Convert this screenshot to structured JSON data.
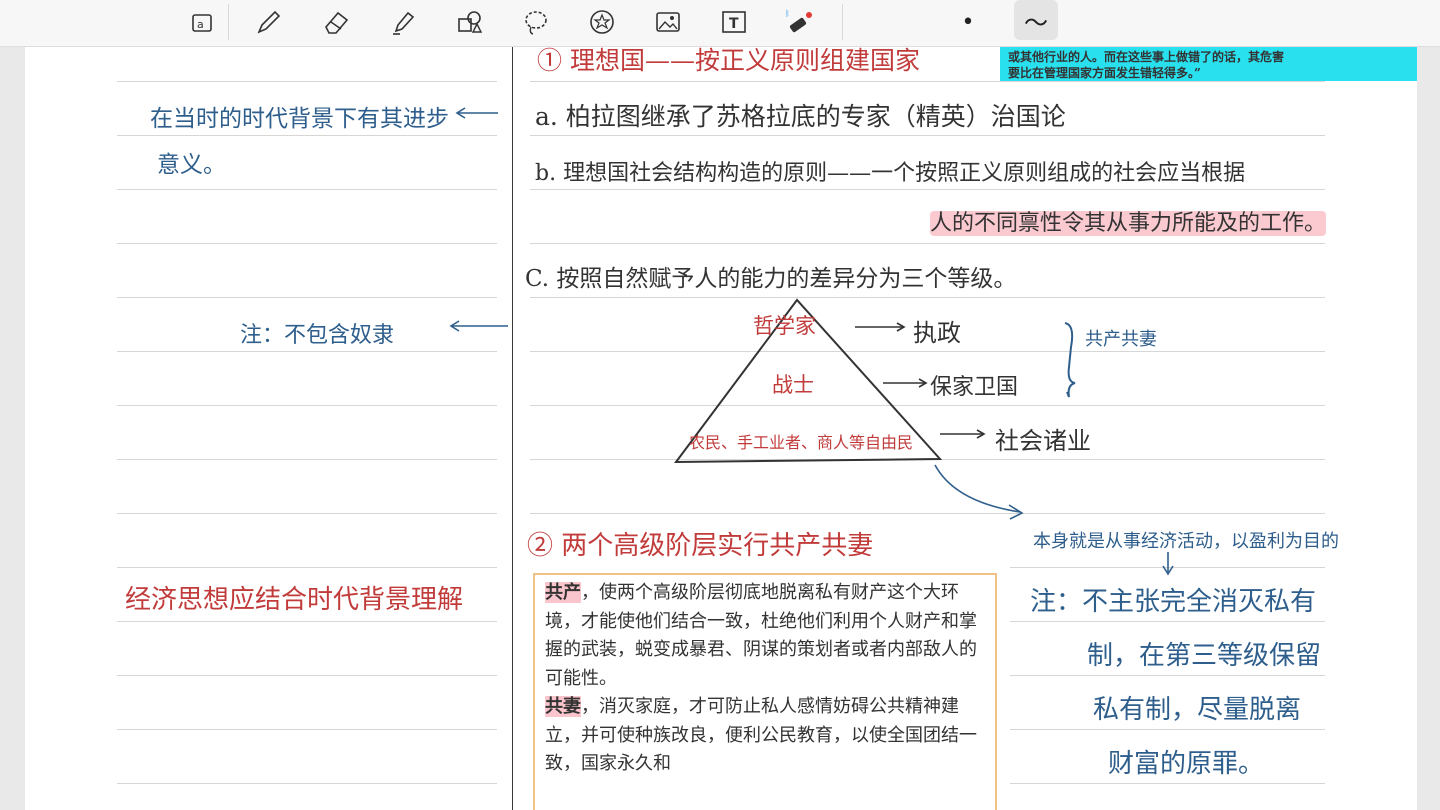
{
  "toolbar": {
    "tools": [
      "lasso-select-icon",
      "pen-icon",
      "eraser-icon",
      "highlighter-icon",
      "shapes-icon",
      "lasso-icon",
      "sticker-icon",
      "image-icon",
      "text-icon",
      "laser-pointer-icon"
    ],
    "pen_size": "•",
    "stroke_style": "～"
  },
  "left_notes": {
    "note1_line1": "在当时的时代背景下有其进步",
    "note1_line2": "意义。",
    "note2": "注：不包含奴隶",
    "note3": "经济思想应结合时代背景理解"
  },
  "main": {
    "heading1": "① 理想国——按正义原则组建国家",
    "item_a": "a. 柏拉图继承了苏格拉底的专家（精英）治国论",
    "item_b_line1": "b. 理想国社会结构构造的原则——一个按照正义原则组成的社会应当根据",
    "item_b_line2": "人的不同禀性令其从事力所能及的工作。",
    "item_c": "C. 按照自然赋予人的能力的差异分为三个等级。",
    "tier_top": "哲学家",
    "tier_mid": "战士",
    "tier_bottom": "农民、手工业者、商人等自由民",
    "role_top": "执政",
    "role_mid": "保家卫国",
    "role_bottom": "社会诸业",
    "brace_note": "共产共妻",
    "heading2": "② 两个高级阶层实行共产共妻"
  },
  "right_notes": {
    "note_a": "本身就是从事经济活动，以盈利为目的",
    "note_b_line1": "注：不主张完全消灭私有",
    "note_b_line2": "制，在第三等级保留",
    "note_b_line3": "私有制，尽量脱离",
    "note_b_line4": "财富的原罪。"
  },
  "cyan_box": {
    "line1": "或其他行业的人。而在这些事上做错了的话，其危害",
    "line2": "要比在管理国家方面发生错轻得多。”"
  },
  "book_excerpt": {
    "kw1": "共产",
    "para1_rest": "，使两个高级阶层彻底地脱离私有财产这个大环境，才能使他们结合一致，杜绝他们利用个人财产和掌握的武装，蜕变成暴君、阴谋的策划者或者内部敌人的可能性。",
    "kw2": "共妻",
    "para2_rest": "，消灭家庭，才可防止私人感情妨碍公共精神建立，并可使种族改良，便利公民教育，以使全国团结一致，国家永久和"
  },
  "colors": {
    "ink_blue": "#2e5e8c",
    "ink_red": "#c23b3b",
    "highlight_pink": "#f69eaa",
    "cyan": "#29e0ef"
  }
}
